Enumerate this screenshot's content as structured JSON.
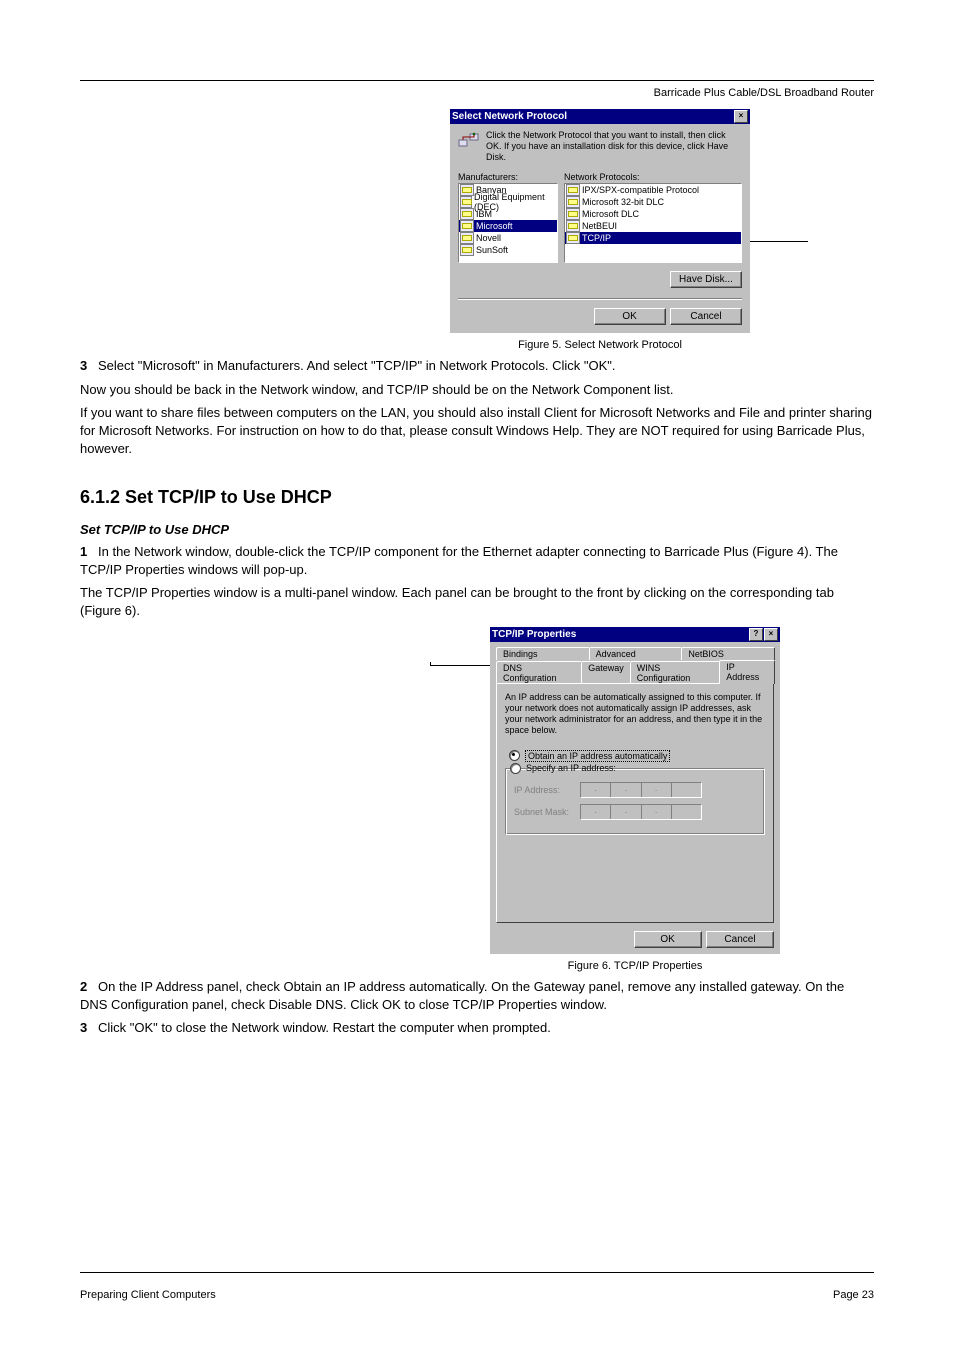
{
  "header": {
    "product": "Barricade Plus Cable/DSL Broadband Router",
    "section": "Preparing Client Computers",
    "page_label": "Page",
    "page_num": "23"
  },
  "fig1": {
    "title": "Select Network Protocol",
    "instruction": "Click the Network Protocol that you want to install, then click OK. If you have an installation disk for this device, click Have Disk.",
    "mfg_label": "Manufacturers:",
    "proto_label": "Network Protocols:",
    "manufacturers": [
      "Banyan",
      "Digital Equipment (DEC)",
      "IBM",
      "Microsoft",
      "Novell",
      "SunSoft"
    ],
    "selected_mfg": "Microsoft",
    "protocols": [
      "IPX/SPX-compatible Protocol",
      "Microsoft 32-bit DLC",
      "Microsoft DLC",
      "NetBEUI",
      "TCP/IP"
    ],
    "selected_proto": "TCP/IP",
    "have_disk": "Have Disk...",
    "ok": "OK",
    "cancel": "Cancel",
    "caption": "Figure 5. Select Network Protocol"
  },
  "para1a_lead": "3",
  "para1a": "Select \"Microsoft\" in Manufacturers. And select \"TCP/IP\" in Network Protocols. Click \"OK\".",
  "para1b": "Now you should be back in the Network window, and TCP/IP should be on the Network Component list.",
  "para1c": "If you want to share files between computers on the LAN, you should also install Client for Microsoft Networks and File and printer sharing for Microsoft Networks. For instruction on how to do that, please consult Windows Help. They are NOT required for using Barricade Plus, however.",
  "title2": "6.1.2 Set TCP/IP to Use DHCP",
  "sub2": "Set TCP/IP to Use DHCP",
  "para2a_lead": "1",
  "para2a": "In the Network window, double-click the TCP/IP component for the Ethernet adapter connecting to Barricade Plus (Figure 4). The TCP/IP Properties windows will pop-up.",
  "para2b": "The TCP/IP Properties window is a multi-panel window. Each panel can be brought to the front by clicking on the corresponding tab (Figure 6).",
  "fig2": {
    "title": "TCP/IP Properties",
    "tabs_row1": [
      "Bindings",
      "Advanced",
      "NetBIOS"
    ],
    "tabs_row2": [
      "DNS Configuration",
      "Gateway",
      "WINS Configuration",
      "IP Address"
    ],
    "selected_tab": "IP Address",
    "description": "An IP address can be automatically assigned to this computer. If your network does not automatically assign IP addresses, ask your network administrator for an address, and then type it in the space below.",
    "radio_obtain": "Obtain an IP address automatically",
    "radio_specify": "Specify an IP address:",
    "ip_label": "IP Address:",
    "mask_label": "Subnet Mask:",
    "ok": "OK",
    "cancel": "Cancel",
    "caption": "Figure 6. TCP/IP Properties"
  },
  "para2c_lead": "2",
  "para2c": "On the IP Address panel, check Obtain an IP address automatically. On the Gateway panel, remove any installed gateway. On the DNS Configuration panel, check Disable DNS. Click OK to close TCP/IP Properties window.",
  "para2d_lead": "3",
  "para2d": "Click \"OK\" to close the Network window. Restart the computer when prompted."
}
